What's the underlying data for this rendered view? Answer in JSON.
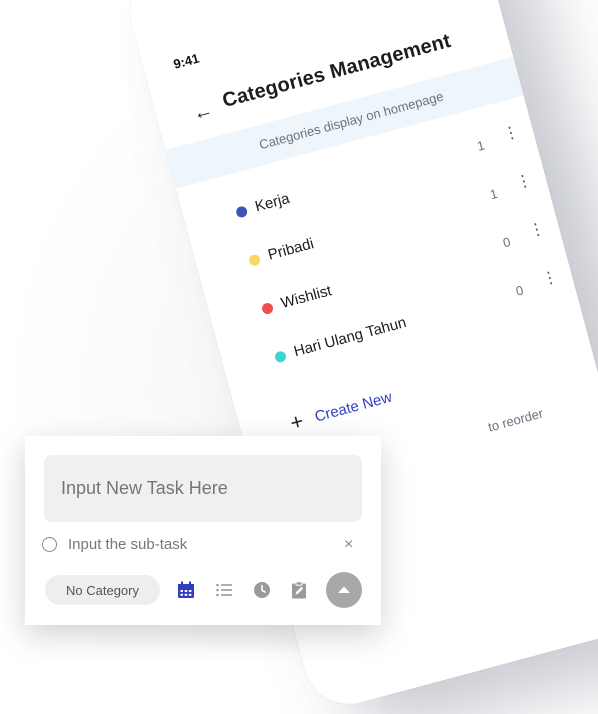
{
  "status": {
    "time": "9:41"
  },
  "header": {
    "title": "Categories Management",
    "subtitle": "Categories display on homepage"
  },
  "categories": [
    {
      "name": "Kerja",
      "count": "1",
      "color": "#3a55b4"
    },
    {
      "name": "Pribadi",
      "count": "1",
      "color": "#f7d95c"
    },
    {
      "name": "Wishlist",
      "count": "0",
      "color": "#ef4f4f"
    },
    {
      "name": "Hari Ulang Tahun",
      "count": "0",
      "color": "#3dd6d6"
    }
  ],
  "create_new": {
    "label": "Create New",
    "icon": "plus-icon"
  },
  "reorder_hint": "to reorder",
  "sheet": {
    "task_placeholder": "Input New Task Here",
    "subtask_placeholder": "Input the sub-task",
    "close_icon": "×",
    "category_button": "No Category",
    "icons": [
      "calendar-icon",
      "list-icon",
      "clock-icon",
      "clipboard-icon",
      "send-up-icon"
    ],
    "accent": "#2f3fbf",
    "inactive": "#9a9a9a"
  }
}
